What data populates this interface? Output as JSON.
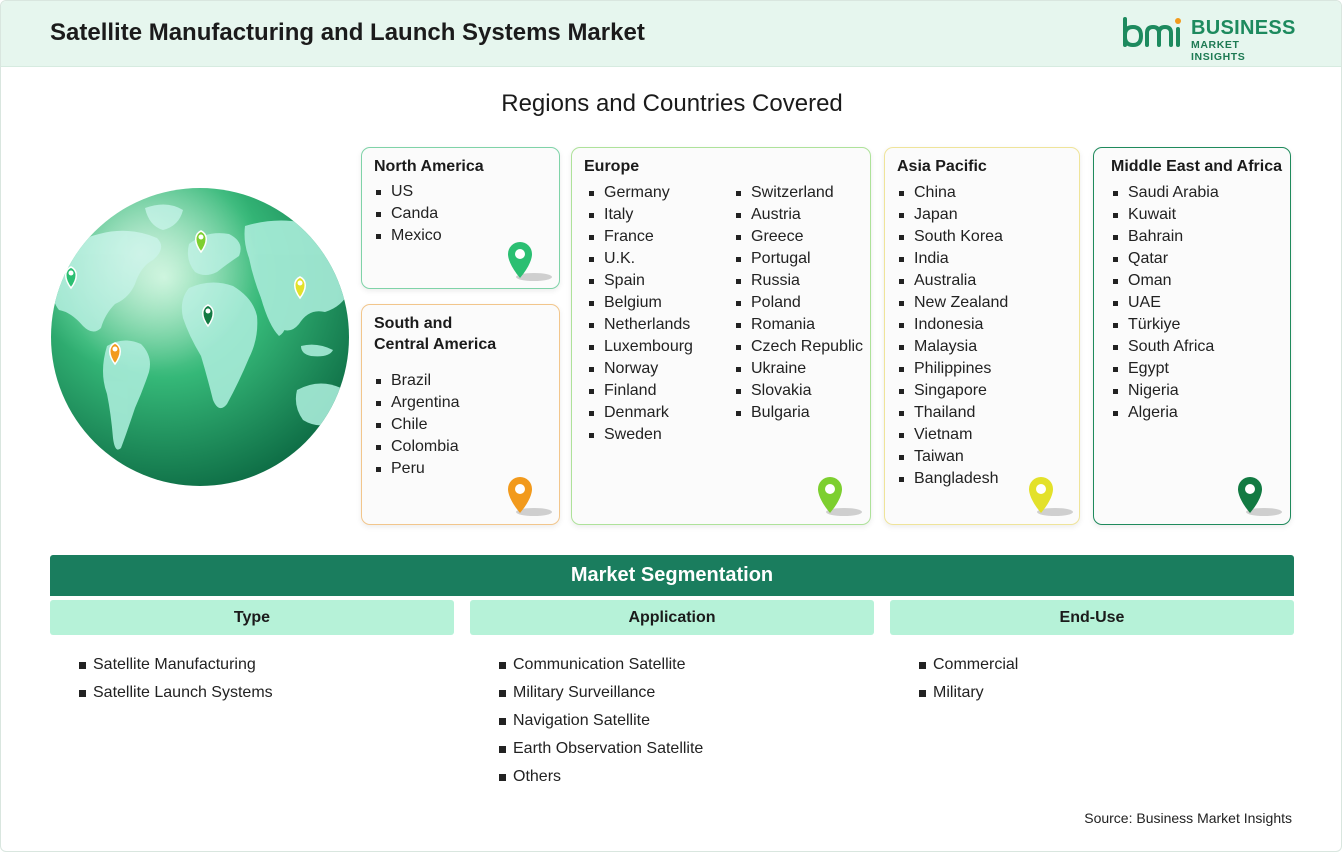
{
  "header": {
    "title": "Satellite Manufacturing and Launch Systems Market",
    "logo_line1": "BUSINESS",
    "logo_line2": "MARKET INSIGHTS",
    "logo_mark_text": "bmi"
  },
  "regions_title": "Regions and Countries Covered",
  "regions": {
    "north_america": {
      "name": "North America",
      "countries": [
        "US",
        "Canda",
        "Mexico"
      ],
      "pin_color": "#2bbf72"
    },
    "south_central_america": {
      "name_line1": "South and",
      "name_line2": "Central America",
      "countries": [
        "Brazil",
        "Argentina",
        "Chile",
        "Colombia",
        "Peru"
      ],
      "pin_color": "#f29a1c"
    },
    "europe": {
      "name": "Europe",
      "countries_col1": [
        "Germany",
        "Italy",
        "France",
        "U.K.",
        "Spain",
        "Belgium",
        "Netherlands",
        "Luxembourg",
        "Norway",
        "Finland",
        "Denmark",
        "Sweden"
      ],
      "countries_col2": [
        "Switzerland",
        "Austria",
        "Greece",
        "Portugal",
        "Russia",
        "Poland",
        "Romania",
        "Czech Republic",
        "Ukraine",
        "Slovakia",
        "Bulgaria"
      ],
      "pin_color": "#7dcf2f"
    },
    "asia_pacific": {
      "name": "Asia Pacific",
      "countries": [
        "China",
        "Japan",
        "South Korea",
        "India",
        "Australia",
        "New Zealand",
        "Indonesia",
        "Malaysia",
        "Philippines",
        "Singapore",
        "Thailand",
        "Vietnam",
        "Taiwan",
        "Bangladesh"
      ],
      "pin_color": "#e3e12a"
    },
    "middle_east_africa": {
      "name": "Middle East and Africa",
      "countries": [
        "Saudi Arabia",
        "Kuwait",
        "Bahrain",
        "Qatar",
        "Oman",
        "UAE",
        "Türkiye",
        "South Africa",
        "Egypt",
        "Nigeria",
        "Algeria"
      ],
      "pin_color": "#127a42"
    }
  },
  "segmentation": {
    "title": "Market Segmentation",
    "columns": [
      {
        "header": "Type",
        "items": [
          "Satellite Manufacturing",
          "Satellite Launch Systems"
        ]
      },
      {
        "header": "Application",
        "items": [
          "Communication Satellite",
          "Military Surveillance",
          "Navigation Satellite",
          "Earth Observation Satellite",
          "Others"
        ]
      },
      {
        "header": "End-Use",
        "items": [
          "Commercial",
          "Military"
        ]
      }
    ]
  },
  "source": "Source: Business Market Insights",
  "colors": {
    "header_bg": "#e6f6ee",
    "brand_green": "#1d8a5e",
    "segmentation_bar": "#1a7d5e",
    "segment_header": "#b6f2d8"
  }
}
